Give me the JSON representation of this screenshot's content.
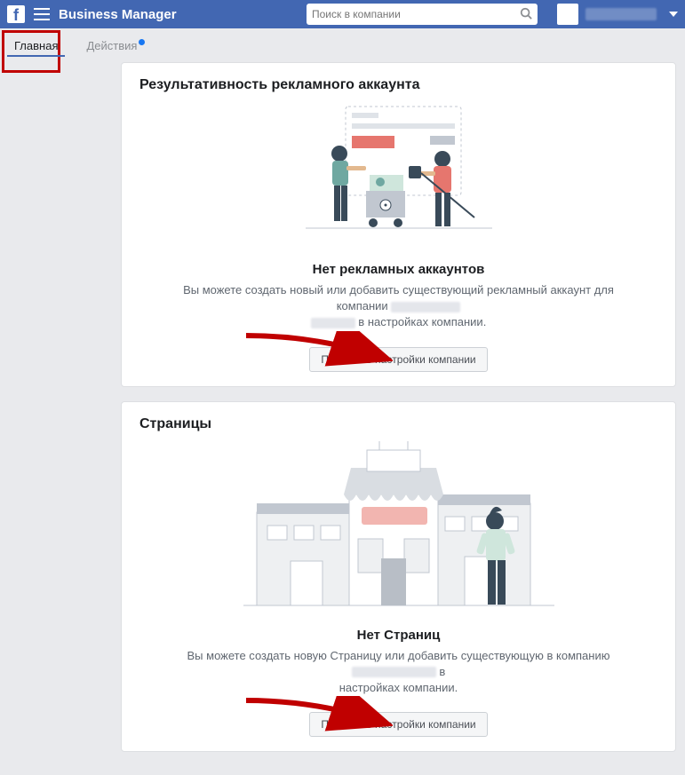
{
  "navbar": {
    "brand": "Business Manager",
    "search_placeholder": "Поиск в компании"
  },
  "tabs": [
    {
      "label": "Главная",
      "active": true
    },
    {
      "label": "Действия",
      "active": false,
      "notif": true
    }
  ],
  "cards": {
    "ad_account": {
      "title": "Результативность рекламного аккаунта",
      "empty_title": "Нет рекламных аккаунтов",
      "empty_desc_a": "Вы можете создать новый или добавить существующий рекламный аккаунт для компании ",
      "empty_desc_b": " в настройках компании.",
      "button": "Перейти в настройки компании"
    },
    "pages": {
      "title": "Страницы",
      "empty_title": "Нет Страниц",
      "empty_desc_a": "Вы можете создать новую Страницу или добавить существующую в компанию ",
      "empty_desc_b": " в настройках компании.",
      "button": "Перейти в настройки компании"
    }
  }
}
